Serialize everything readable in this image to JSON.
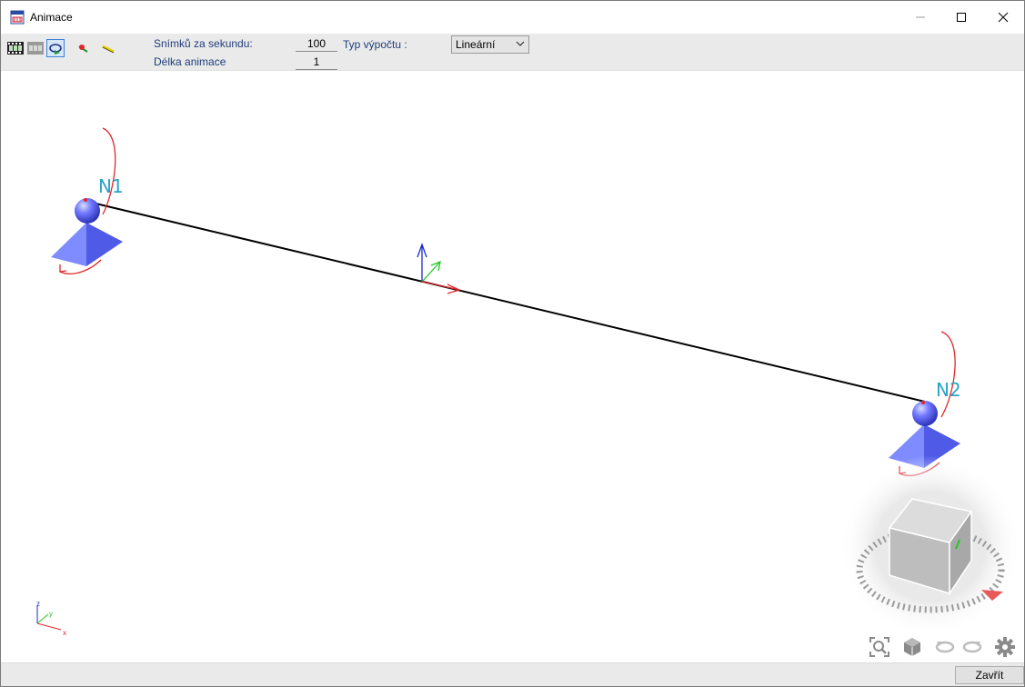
{
  "window": {
    "title": "Animace",
    "minimize_icon": "minimize-icon",
    "maximize_icon": "maximize-icon",
    "close_icon": "close-icon"
  },
  "toolbar": {
    "icons": [
      "filmstrip-icon",
      "filmstrip-grid-icon",
      "rotate-view-icon",
      "red-marker-icon",
      "yellow-marker-icon"
    ],
    "fps_label": "Snímků za sekundu:",
    "fps_value": "100",
    "duration_label": "Délka animace",
    "duration_value": "1",
    "calc_type_label": "Typ výpočtu :",
    "calc_type_value": "Lineární"
  },
  "viewport": {
    "nodes": [
      {
        "name": "N1"
      },
      {
        "name": "N2"
      }
    ],
    "axes": {
      "z": "z",
      "y": "y",
      "x": "x"
    },
    "tools": [
      "zoom-extents-icon",
      "view-cube-icon",
      "rotate-left-icon",
      "rotate-right-icon",
      "settings-gear-icon"
    ]
  },
  "footer": {
    "close_label": "Zavřít"
  },
  "colors": {
    "support": "#6a78ef",
    "beam": "#000000",
    "node_label": "#29a3c7",
    "rotation_arrow": "#e0262b"
  }
}
